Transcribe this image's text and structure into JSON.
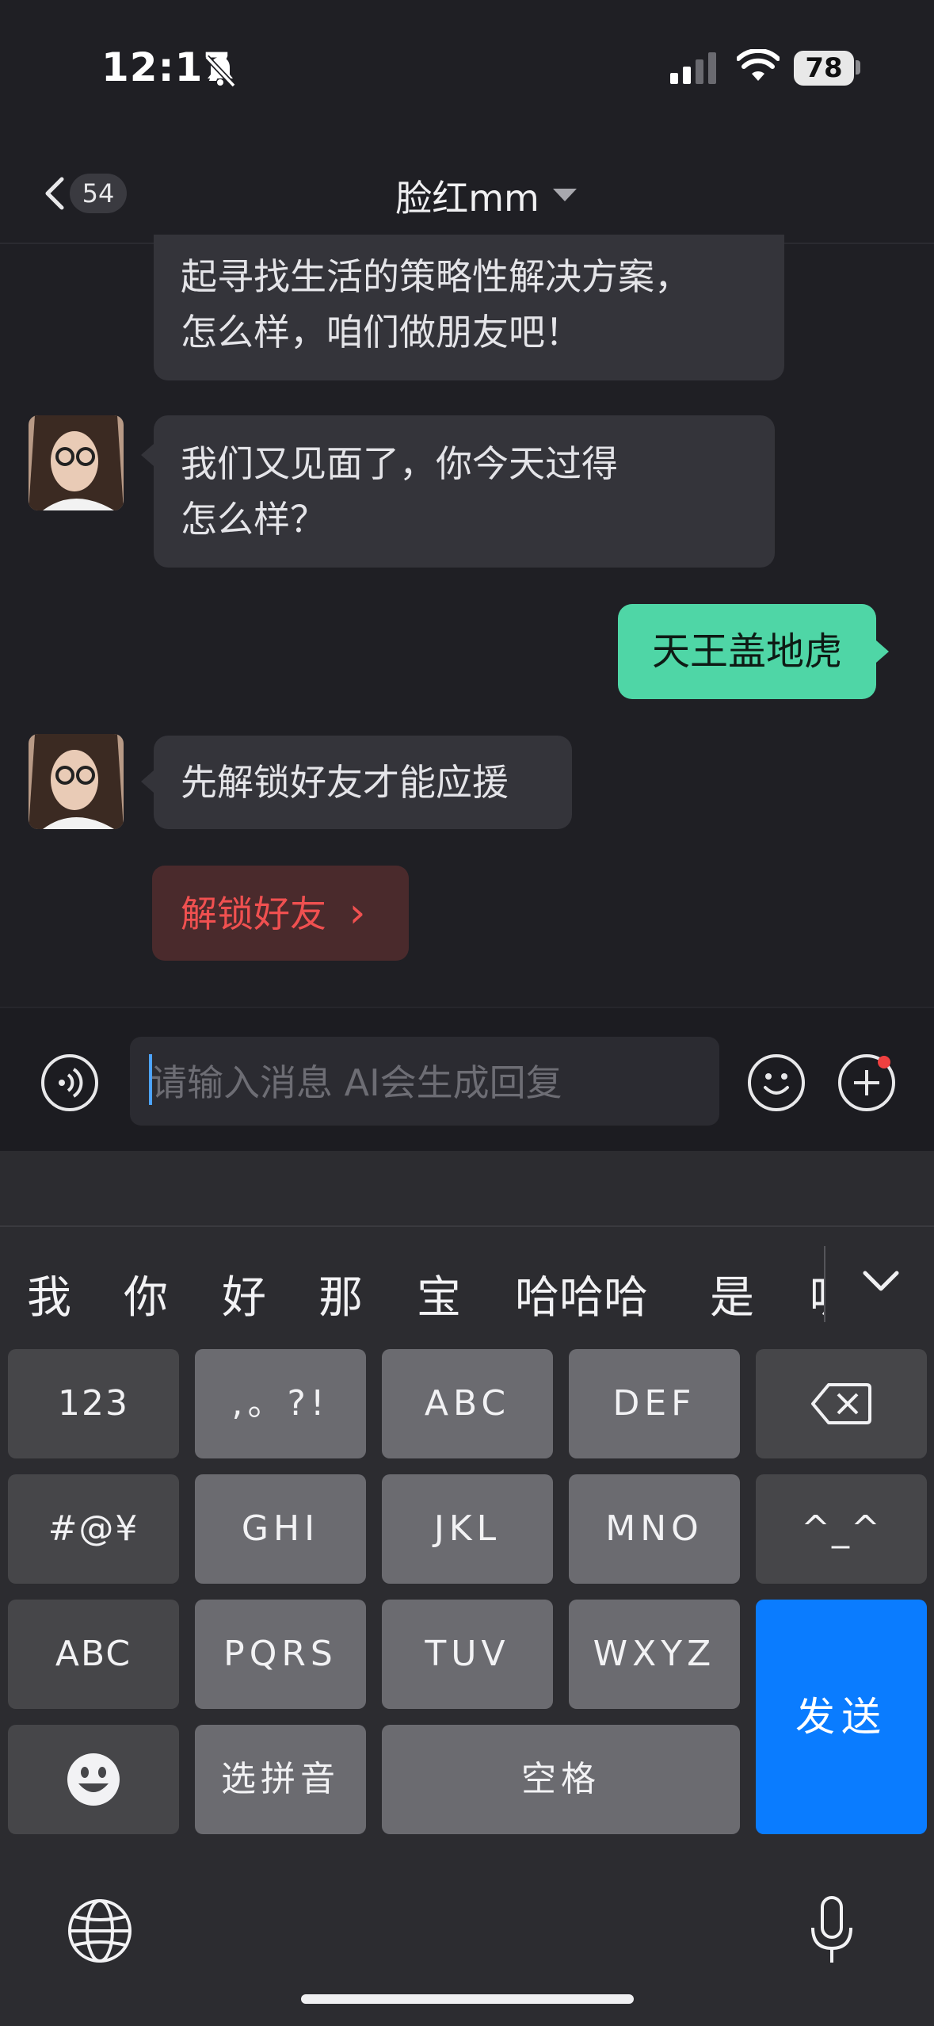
{
  "status_bar": {
    "time": "12:17",
    "battery": "78"
  },
  "header": {
    "back_count": "54",
    "title": "脸红mm"
  },
  "messages": {
    "m1": {
      "line1": "起寻找生活的策略性解决方案，",
      "line2": "怎么样，咱们做朋友吧！"
    },
    "m2": {
      "line1": "我们又见面了，你今天过得",
      "line2": "怎么样？"
    },
    "m3": {
      "text": "天王盖地虎"
    },
    "m4": {
      "text": "先解锁好友才能应援"
    },
    "unlock_button": {
      "label": "解锁好友",
      "arrow": "›"
    }
  },
  "input": {
    "placeholder": "请输入消息 AI会生成回复"
  },
  "keyboard": {
    "candidates": [
      "我",
      "你",
      "好",
      "那",
      "宝",
      "哈哈哈",
      "是",
      "呢"
    ],
    "keys": {
      "num": "123",
      "punct": ",。?!",
      "abc": "ABC",
      "def": "DEF",
      "symbols": "#@¥",
      "ghi": "GHI",
      "jkl": "JKL",
      "mno": "MNO",
      "emoticon": "^_^",
      "abc2": "ABC",
      "pqrs": "PQRS",
      "tuv": "TUV",
      "wxyz": "WXYZ",
      "send": "发送",
      "pinyin": "选拼音",
      "space": "空格"
    }
  },
  "colors": {
    "background": "#1f1f24",
    "bubble": "#34343a",
    "my_bubble": "#4fd6a6",
    "unlock": "#f05050",
    "send": "#0a7cff"
  }
}
